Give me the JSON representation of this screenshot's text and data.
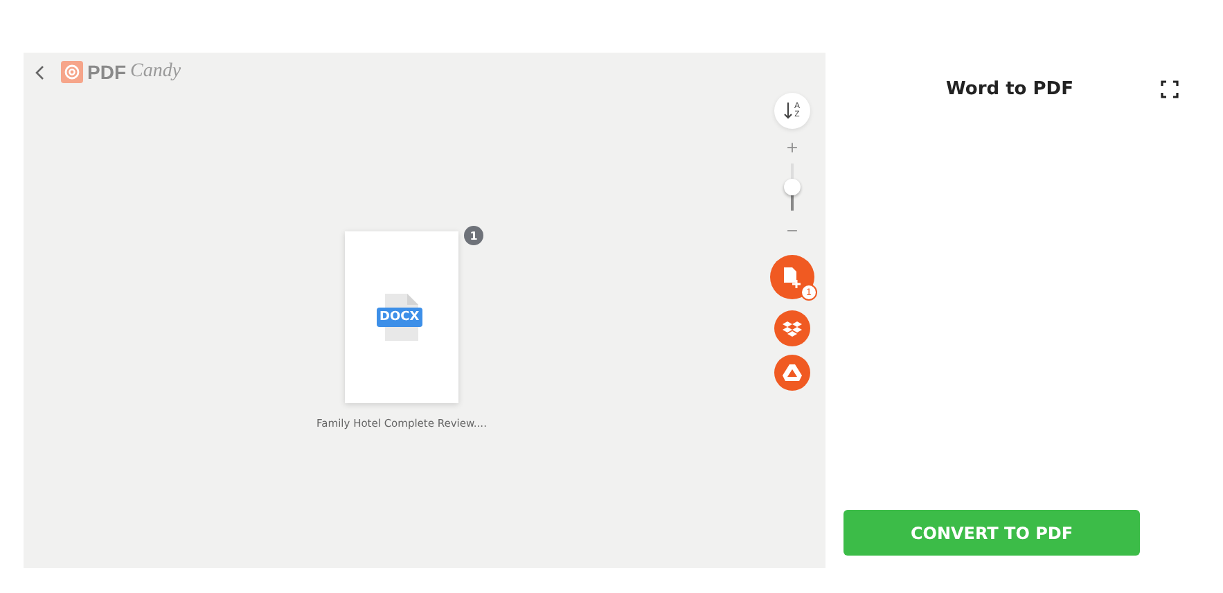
{
  "logo": {
    "brand": "PDF",
    "suffix": "Candy"
  },
  "file": {
    "name": "Family Hotel Complete Review....",
    "type": "DOCX",
    "count": "1"
  },
  "tools": {
    "sort_letters": [
      "A",
      "Z"
    ],
    "zoom_in": "+",
    "zoom_out": "−",
    "level": 0.5,
    "upload_badge": "1"
  },
  "panel": {
    "title": "Word to PDF",
    "button": "CONVERT TO PDF"
  }
}
